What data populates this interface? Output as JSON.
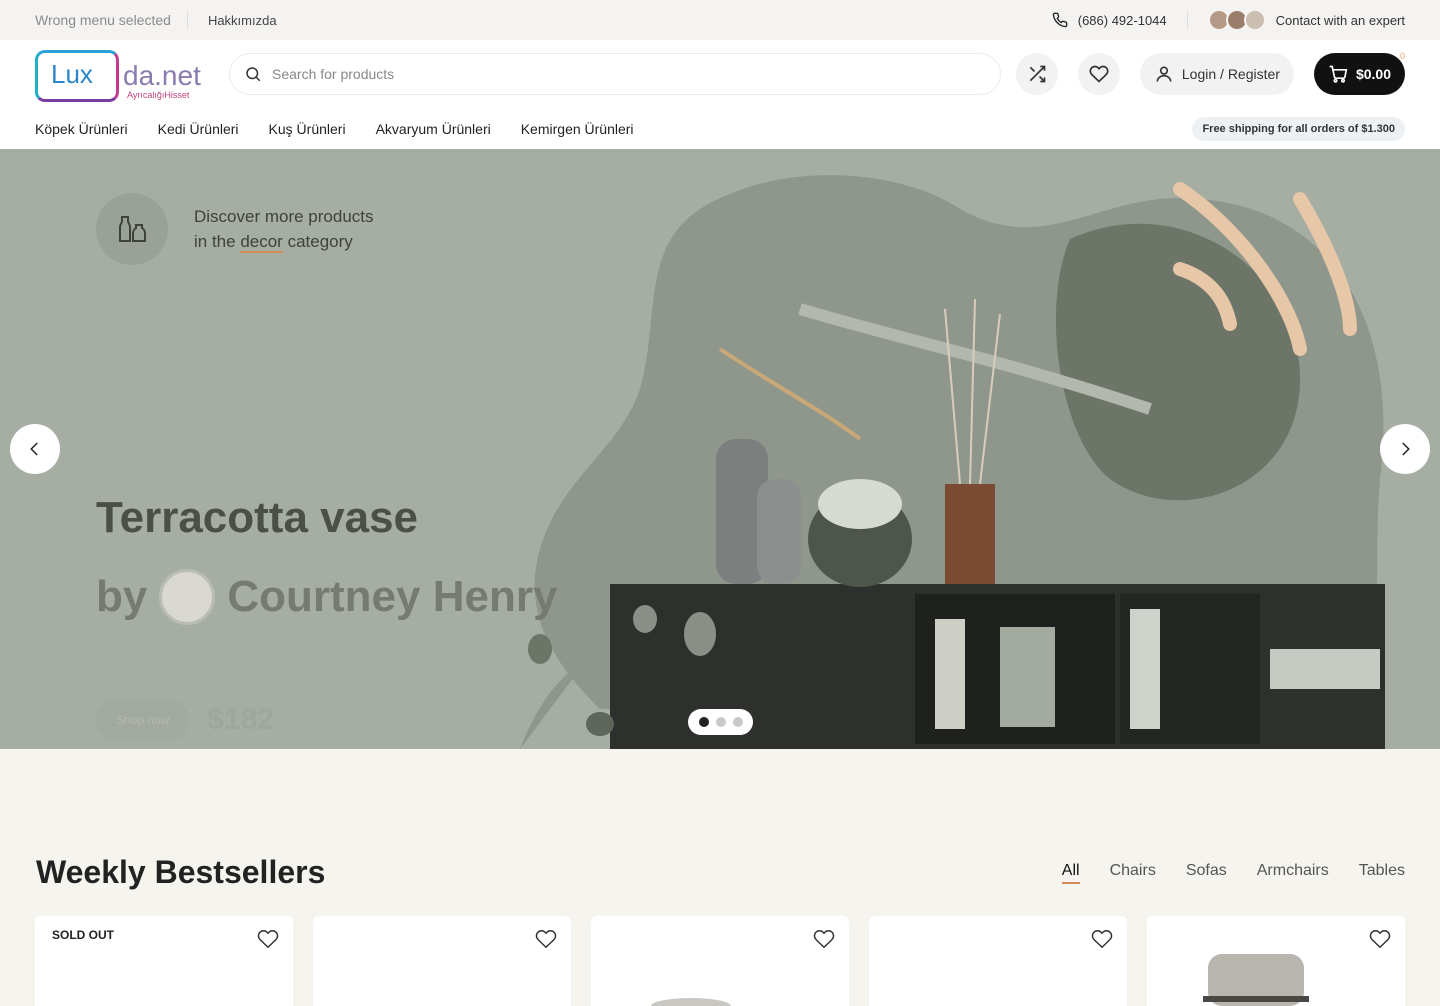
{
  "topbar": {
    "wrong_menu": "Wrong menu selected",
    "about": "Hakkımızda",
    "phone": "(686) 492-1044",
    "contact": "Contact with an expert"
  },
  "header": {
    "logo_main": "Lux",
    "logo_domain": "da.net",
    "logo_tagline": "AyrıcalığıHisset",
    "search_placeholder": "Search for products",
    "login_label": "Login / Register",
    "cart_total": "$0.00",
    "cart_count": "0"
  },
  "nav": {
    "items": [
      "Köpek Ürünleri",
      "Kedi Ürünleri",
      "Kuş Ürünleri",
      "Akvaryum Ürünleri",
      "Kemirgen Ürünleri"
    ],
    "shipping_badge": "Free shipping for all orders of $1.300"
  },
  "hero": {
    "discover_line1": "Discover more products",
    "discover_line2_pre": "in the ",
    "discover_line2_link": "decor",
    "discover_line2_post": " category",
    "title": "Terracotta vase",
    "by": "by",
    "author": "Courtney Henry",
    "shop_label": "Shop now",
    "price": "$182",
    "slides": 3,
    "active_slide": 1
  },
  "bestsellers": {
    "title": "Weekly Bestsellers",
    "filters": [
      "All",
      "Chairs",
      "Sofas",
      "Armchairs",
      "Tables"
    ],
    "active_filter": "All",
    "sold_out_label": "SOLD OUT"
  },
  "colors": {
    "accent": "#d48b5a",
    "hero_bg": "#a6ada3",
    "cart_bg": "#111111"
  }
}
